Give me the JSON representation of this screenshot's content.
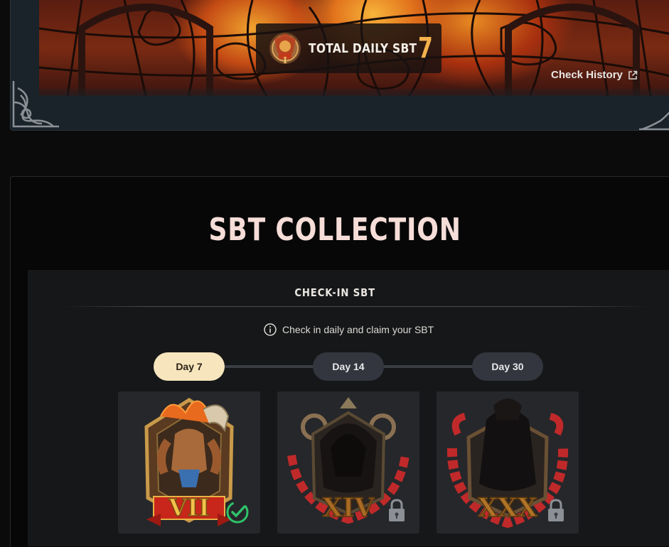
{
  "banner": {
    "total_label": "TOTAL DAILY SBT",
    "total_value": "7",
    "check_history_label": "Check History"
  },
  "collection": {
    "title": "SBT COLLECTION",
    "checkin": {
      "heading": "CHECK-IN SBT",
      "info_text": "Check in daily and claim your SBT",
      "days": [
        {
          "label": "Day 7",
          "state": "active",
          "badge_numeral": "VII",
          "status": "claimed"
        },
        {
          "label": "Day 14",
          "state": "inactive",
          "badge_numeral": "XIV",
          "status": "locked"
        },
        {
          "label": "Day 30",
          "state": "inactive",
          "badge_numeral": "XXX",
          "status": "locked"
        }
      ]
    }
  },
  "colors": {
    "accent_gold": "#f4b14d",
    "active_pill": "#f7e5bd",
    "inactive_pill": "#34363f",
    "claimed_check": "#2fc36a"
  }
}
